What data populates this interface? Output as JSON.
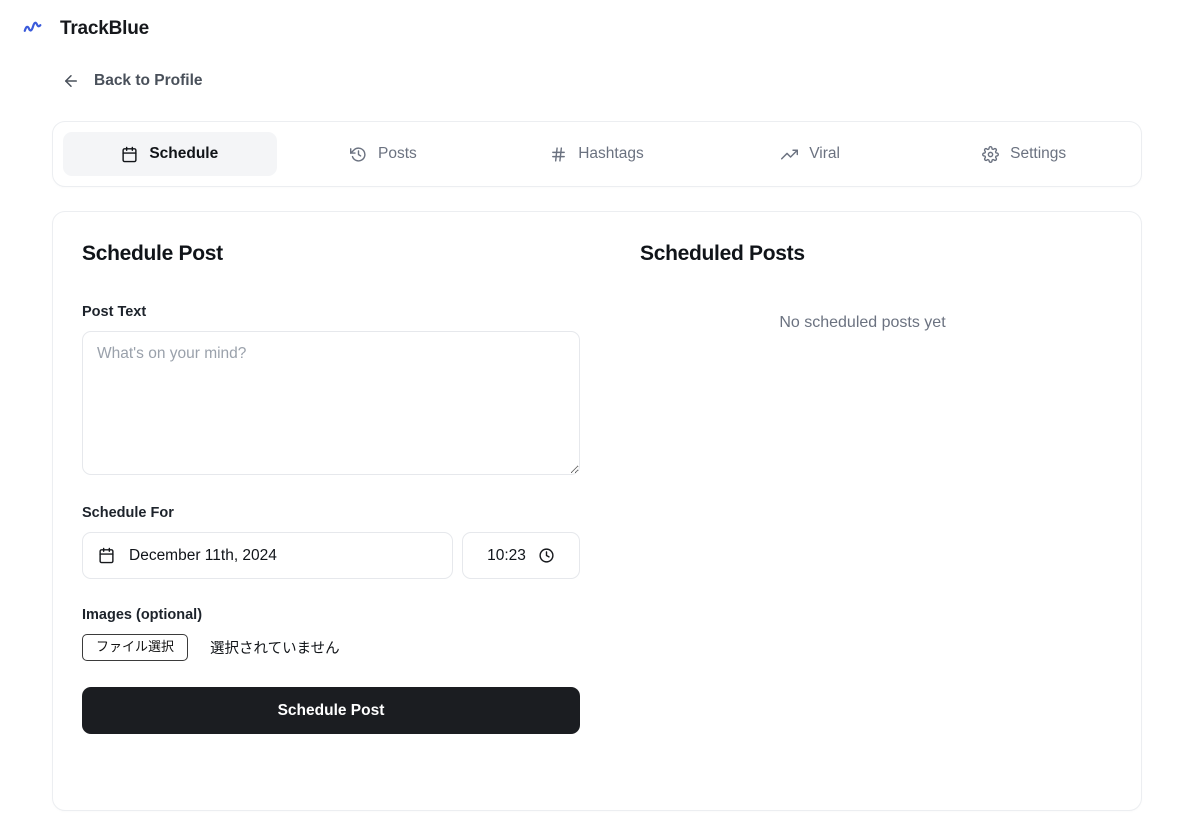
{
  "header": {
    "logo_icon": "activity-line-icon",
    "brand": "TrackBlue",
    "brand_color": "#3b5bdb"
  },
  "nav": {
    "back_icon": "arrow-left-icon",
    "back_label": "Back to Profile"
  },
  "tabs": [
    {
      "id": "schedule",
      "label": "Schedule",
      "icon": "calendar-icon",
      "active": true
    },
    {
      "id": "posts",
      "label": "Posts",
      "icon": "history-clock-icon",
      "active": false
    },
    {
      "id": "hashtags",
      "label": "Hashtags",
      "icon": "hash-icon",
      "active": false
    },
    {
      "id": "viral",
      "label": "Viral",
      "icon": "trending-up-icon",
      "active": false
    },
    {
      "id": "settings",
      "label": "Settings",
      "icon": "gear-icon",
      "active": false
    }
  ],
  "compose": {
    "title": "Schedule Post",
    "post_text_label": "Post Text",
    "post_text_value": "",
    "post_text_placeholder": "What's on your mind?",
    "schedule_for_label": "Schedule For",
    "date_icon": "calendar-icon",
    "date_value": "December 11th, 2024",
    "time_value": "10:23",
    "time_icon": "clock-icon",
    "images_label": "Images (optional)",
    "file_button_label": "ファイル選択",
    "file_status_text": "選択されていません",
    "submit_label": "Schedule Post",
    "submit_bg": "#1b1d21"
  },
  "scheduled": {
    "title": "Scheduled Posts",
    "empty_text": "No scheduled posts yet"
  }
}
